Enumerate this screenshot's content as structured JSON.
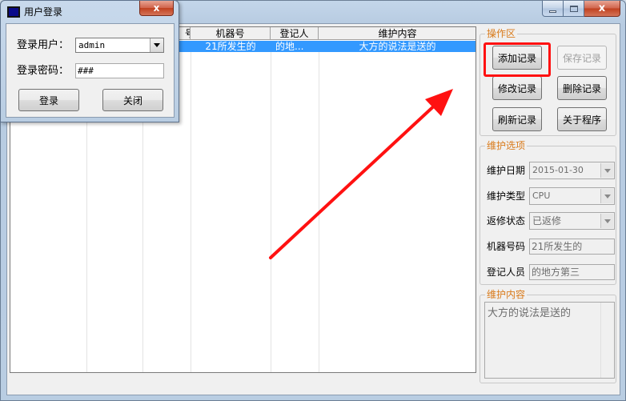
{
  "main_window": {
    "grid": {
      "headers": [
        "号",
        "机器号",
        "登记人",
        "维护内容"
      ],
      "row": [
        "21所发生的",
        "的地...",
        "大方的说法是送的"
      ]
    },
    "ops": {
      "title": "操作区",
      "add": "添加记录",
      "save": "保存记录",
      "edit": "修改记录",
      "delete": "删除记录",
      "refresh": "刷新记录",
      "about": "关于程序"
    },
    "maint": {
      "title": "维护选项",
      "date_label": "维护日期",
      "date_value": "2015-01-30",
      "type_label": "维护类型",
      "type_value": "CPU",
      "status_label": "返修状态",
      "status_value": "已返修",
      "machine_label": "机器号码",
      "machine_value": "21所发生的",
      "person_label": "登记人员",
      "person_value": "的地方第三"
    },
    "content": {
      "title": "维护内容",
      "text": "大方的说法是送的"
    },
    "close_glyph": "x"
  },
  "login_dialog": {
    "title": "用户登录",
    "user_label": "登录用户：",
    "user_value": "admin",
    "password_label": "登录密码：",
    "password_value": "###",
    "login_button": "登录",
    "close_button": "关闭",
    "close_glyph": "x"
  },
  "colors": {
    "accent_orange": "#d97a1a",
    "selection_blue": "#3399ff",
    "highlight_red": "#ff1111"
  }
}
